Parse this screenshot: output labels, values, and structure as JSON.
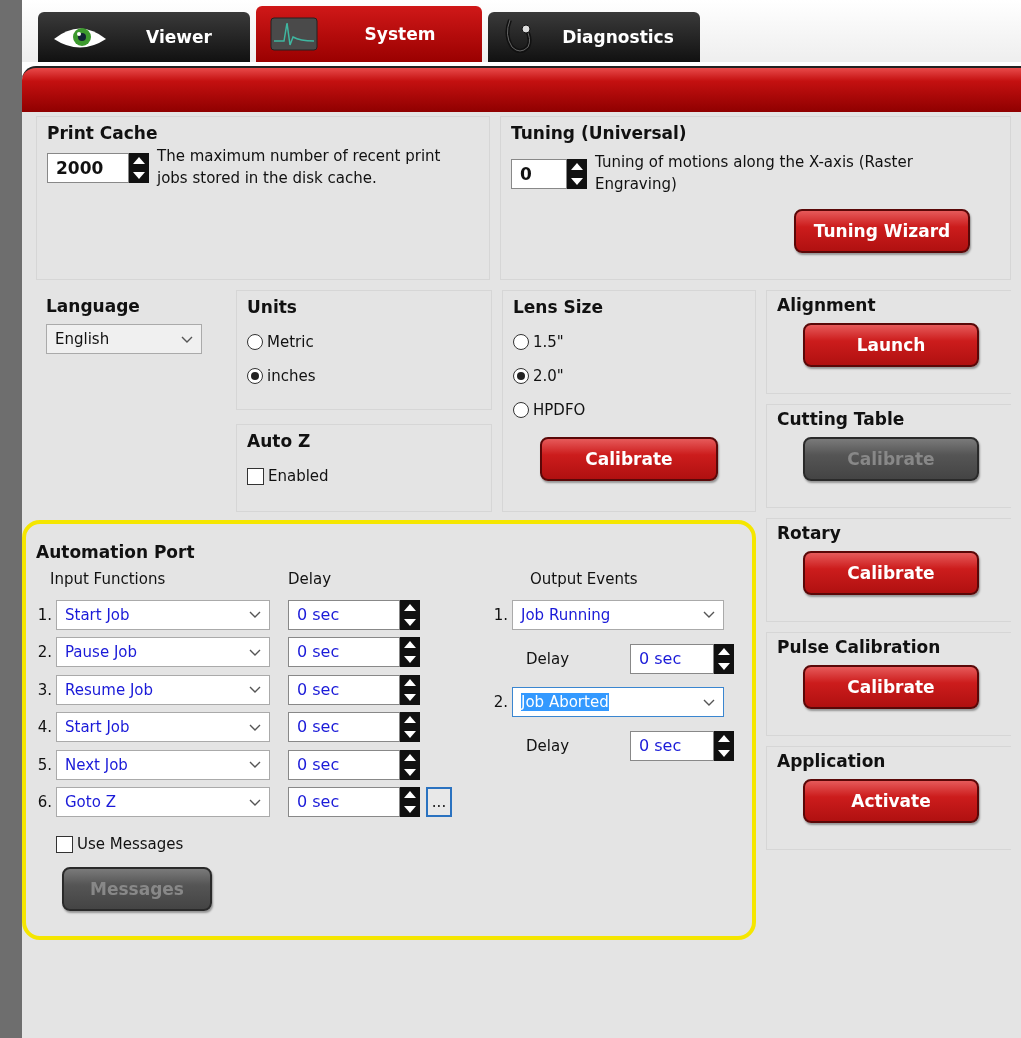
{
  "tabs": [
    {
      "label": "Viewer",
      "selected": false
    },
    {
      "label": "System",
      "selected": true
    },
    {
      "label": "Diagnostics",
      "selected": false
    }
  ],
  "print_cache": {
    "title": "Print Cache",
    "value": "2000",
    "description": "The maximum number of recent print jobs stored in the disk cache."
  },
  "tuning": {
    "title": "Tuning (Universal)",
    "value": "0",
    "description": "Tuning of motions along the X-axis (Raster Engraving)",
    "button": {
      "label": "Tuning Wizard",
      "disabled": false
    }
  },
  "language": {
    "title": "Language",
    "value": "English"
  },
  "units": {
    "title": "Units",
    "options": [
      {
        "label": "Metric",
        "selected": false
      },
      {
        "label": "inches",
        "selected": true
      }
    ]
  },
  "auto_z": {
    "title": "Auto Z",
    "checkbox": {
      "label": "Enabled",
      "checked": false
    }
  },
  "lens_size": {
    "title": "Lens Size",
    "options": [
      {
        "label": "1.5\"",
        "selected": false
      },
      {
        "label": "2.0\"",
        "selected": true
      },
      {
        "label": "HPDFO",
        "selected": false
      }
    ],
    "button": {
      "label": "Calibrate",
      "disabled": false
    }
  },
  "right_sections": [
    {
      "title": "Alignment",
      "button": {
        "label": "Launch",
        "disabled": false
      }
    },
    {
      "title": "Cutting Table",
      "button": {
        "label": "Calibrate",
        "disabled": true
      }
    },
    {
      "title": "Rotary",
      "button": {
        "label": "Calibrate",
        "disabled": false
      }
    },
    {
      "title": "Pulse Calibration",
      "button": {
        "label": "Calibrate",
        "disabled": false
      }
    },
    {
      "title": "Application",
      "button": {
        "label": "Activate",
        "disabled": false
      }
    }
  ],
  "automation_port": {
    "title": "Automation Port",
    "input_header": "Input Functions",
    "delay_header": "Delay",
    "output_header": "Output Events",
    "inputs": [
      {
        "number": "1.",
        "function": "Start Job",
        "delay": "0 sec"
      },
      {
        "number": "2.",
        "function": "Pause Job",
        "delay": "0 sec"
      },
      {
        "number": "3.",
        "function": "Resume Job",
        "delay": "0 sec"
      },
      {
        "number": "4.",
        "function": "Start Job",
        "delay": "0 sec"
      },
      {
        "number": "5.",
        "function": "Next Job",
        "delay": "0 sec"
      },
      {
        "number": "6.",
        "function": "Goto Z",
        "delay": "0 sec"
      }
    ],
    "more_button": "...",
    "use_messages": {
      "label": "Use Messages",
      "checked": false
    },
    "messages_button": {
      "label": "Messages",
      "disabled": true
    },
    "outputs": [
      {
        "number": "1.",
        "event": "Job Running",
        "highlighted": false,
        "delay_label": "Delay",
        "delay": "0 sec"
      },
      {
        "number": "2.",
        "event": "Job Aborted",
        "highlighted": true,
        "delay_label": "Delay",
        "delay": "0 sec"
      }
    ]
  }
}
